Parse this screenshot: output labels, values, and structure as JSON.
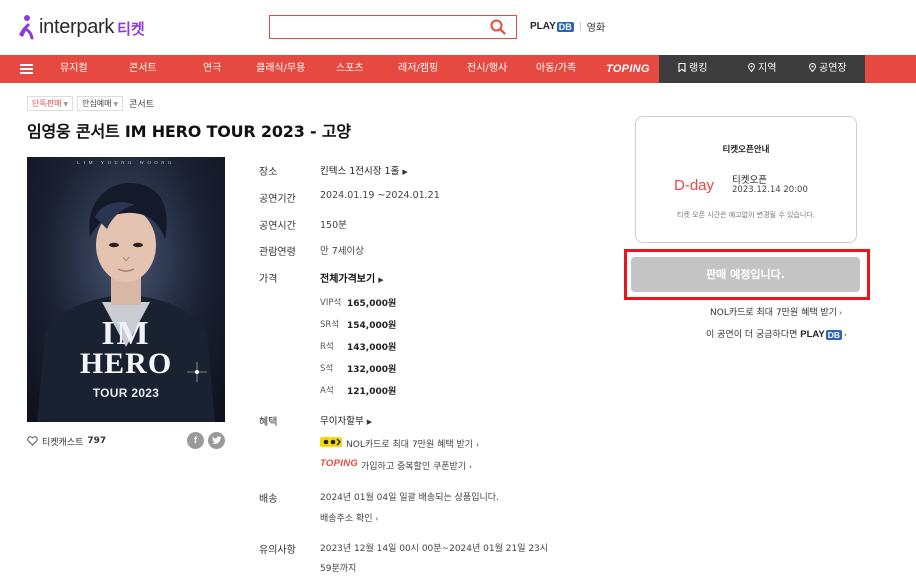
{
  "header": {
    "logo_text": "interpark",
    "logo_sub": "티켓",
    "search_placeholder": "",
    "playdb_text": "PLAY",
    "playdb_db": "DB",
    "movie_link": "영화"
  },
  "nav": {
    "items": [
      "뮤지컬",
      "콘서트",
      "연극",
      "클래식/무용",
      "스포츠",
      "레저/캠핑",
      "전시/행사",
      "아동/가족",
      "TOPING"
    ],
    "dark_items": [
      "랭킹",
      "지역",
      "공연장"
    ],
    "accent_color": "#e5493f",
    "dark_color": "#3d3d3d"
  },
  "product": {
    "tags": [
      "단독판매",
      "안심예매"
    ],
    "category": "콘서트",
    "title": "임영웅 콘서트 IM HERO TOUR 2023 - 고양"
  },
  "poster": {
    "top_text": "LIM YOUNG WOONG",
    "line1": "IM",
    "line2": "HERO",
    "line3": "TOUR 2023"
  },
  "poster_actions": {
    "cast_label": "티켓캐스트",
    "cast_count": "797",
    "share_facebook": "f",
    "share_twitter": "t"
  },
  "info": {
    "venue_label": "장소",
    "venue_value": "킨텍스 1전시장 1홀",
    "period_label": "공연기간",
    "period_value": "2024.01.19 ~2024.01.21",
    "duration_label": "공연시간",
    "duration_value": "150분",
    "age_label": "관람연령",
    "age_value": "만 7세이상",
    "price_label": "가격",
    "price_all": "전체가격보기",
    "prices": [
      {
        "grade": "VIP석",
        "amount": "165,000원"
      },
      {
        "grade": "SR석",
        "amount": "154,000원"
      },
      {
        "grade": "R석",
        "amount": "143,000원"
      },
      {
        "grade": "S석",
        "amount": "132,000원"
      },
      {
        "grade": "A석",
        "amount": "121,000원"
      }
    ],
    "benefit_label": "혜택",
    "benefit_value": "무이자할부",
    "benefit_nol": "NOL카드로 최대 7만원 혜택 받기",
    "benefit_toping_logo": "TOPING",
    "benefit_toping": "가입하고 중복할인 쿠폰받기",
    "delivery_label": "배송",
    "delivery_value": "2024년 01월 04일 일괄 배송되는 상품입니다.",
    "delivery_link": "배송주소 확인",
    "notice_label": "유의사항",
    "notice_line1": "2023년 12월 14일 00시 00분~2024년 01월 21일 23시",
    "notice_line2": "59분까지"
  },
  "right_panel": {
    "open_title": "티켓오픈안내",
    "dday": "D-day",
    "open_label": "티켓오픈",
    "open_date": "2023.12.14 20:00",
    "open_note": "티켓 오픈 시간은 예고없이 변경될 수 있습니다.",
    "sale_button": "판매 예정입니다.",
    "nol_link": "NOL카드로 최대 7만원 혜택 받기",
    "playdb_prefix": "이 공연이 더 궁금하다면",
    "playdb_text": "PLAY",
    "playdb_db": "DB"
  }
}
